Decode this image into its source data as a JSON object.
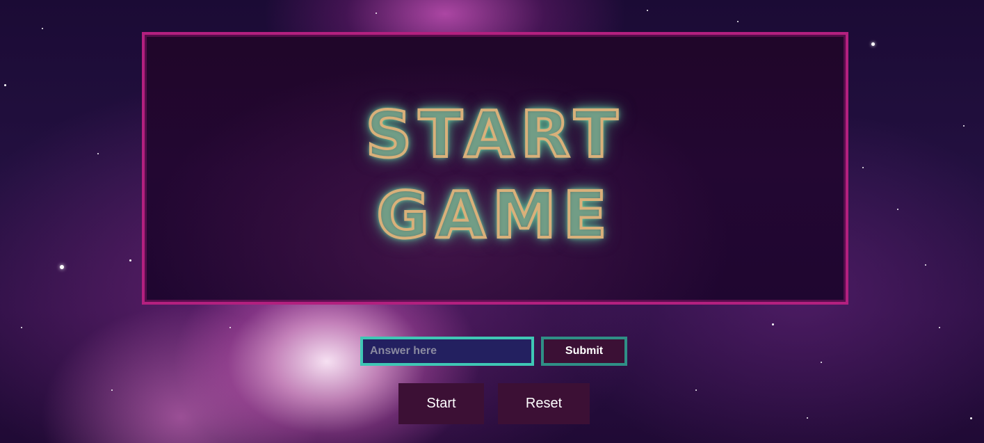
{
  "banner": {
    "line1": "START",
    "line2": "GAME"
  },
  "answer": {
    "placeholder": "Answer here",
    "value": ""
  },
  "buttons": {
    "submit": "Submit",
    "start": "Start",
    "reset": "Reset"
  },
  "colors": {
    "banner_border": "#b3207f",
    "input_border": "#3fc7b5",
    "button_bg": "#3c1035"
  }
}
